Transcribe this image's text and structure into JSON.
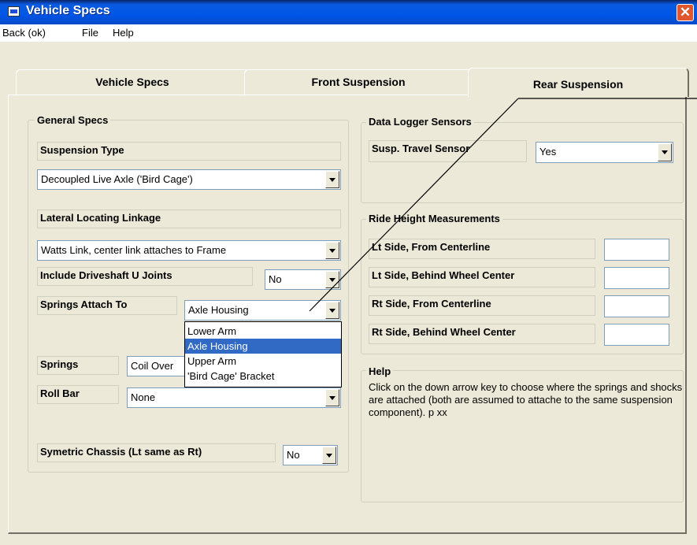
{
  "window": {
    "title": "Vehicle Specs",
    "close_symbol": "✕"
  },
  "menu": {
    "items": [
      "Back (ok)",
      "File",
      "Help"
    ]
  },
  "tabs": [
    "Vehicle Specs",
    "Front Suspension",
    "Rear Suspension"
  ],
  "active_tab": "Rear Suspension",
  "general_specs": {
    "title": "General Specs",
    "suspension_type": {
      "label": "Suspension Type",
      "value": "Decoupled Live Axle ('Bird Cage')"
    },
    "lateral_linkage": {
      "label": "Lateral Locating Linkage",
      "value": "Watts Link, center link attaches to Frame"
    },
    "driveshaft": {
      "label": "Include Driveshaft U Joints",
      "value": "No"
    },
    "springs_attach": {
      "label": "Springs Attach To",
      "value": "Axle Housing",
      "options": [
        "Lower Arm",
        "Axle Housing",
        "Upper Arm",
        "'Bird Cage' Bracket"
      ],
      "selected_option": "Axle Housing"
    },
    "springs": {
      "label": "Springs",
      "value": "Coil Over"
    },
    "roll_bar": {
      "label": "Roll Bar",
      "value": "None"
    },
    "symmetric": {
      "label": "Symetric Chassis (Lt same as Rt)",
      "value": "No"
    }
  },
  "data_logger": {
    "title": "Data Logger Sensors",
    "susp_travel": {
      "label": "Susp. Travel Sensor",
      "value": "Yes"
    }
  },
  "ride_height": {
    "title": "Ride Height Measurements",
    "fields": [
      {
        "label": "Lt Side, From Centerline",
        "value": ""
      },
      {
        "label": "Lt Side, Behind Wheel Center",
        "value": ""
      },
      {
        "label": "Rt Side, From Centerline",
        "value": ""
      },
      {
        "label": "Rt Side, Behind Wheel Center",
        "value": ""
      }
    ]
  },
  "help": {
    "title": "Help",
    "text": "Click on the down arrow key to choose where the springs and shocks are attached (both are assumed to attache to the same suspension component).  p xx"
  }
}
